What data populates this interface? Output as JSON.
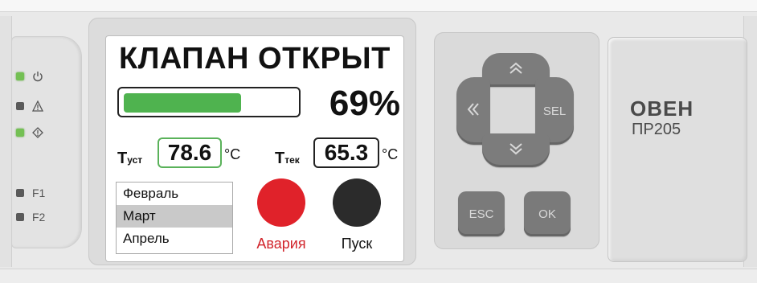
{
  "indicators": [
    {
      "led": "green",
      "icon": "power-icon",
      "label": ""
    },
    {
      "led": "gray",
      "icon": "warning-icon",
      "label": ""
    },
    {
      "led": "green",
      "icon": "diamond-icon",
      "label": ""
    },
    {
      "led": "gray",
      "icon": "",
      "label": "F1"
    },
    {
      "led": "gray",
      "icon": "",
      "label": "F2"
    }
  ],
  "screen": {
    "title": "КЛАПАН ОТКРЫТ",
    "progress": {
      "percent_text": "69%",
      "fraction": 0.69
    },
    "t_set": {
      "label": "T",
      "sub": "уст",
      "value": "78.6",
      "unit": "°C"
    },
    "t_cur": {
      "label": "T",
      "sub": "тек",
      "value": "65.3",
      "unit": "°C"
    },
    "months": [
      {
        "label": "Февраль",
        "selected": false
      },
      {
        "label": "Март",
        "selected": true
      },
      {
        "label": "Апрель",
        "selected": false
      }
    ],
    "alarm_label": "Авария",
    "start_label": "Пуск"
  },
  "keypad": {
    "up": "up-double-chevron-icon",
    "left": "left-double-chevron-icon",
    "down": "down-double-chevron-icon",
    "sel": "SEL",
    "esc": "ESC",
    "ok": "OK"
  },
  "brand": {
    "name": "ОВЕН",
    "model": "ПР205"
  },
  "colors": {
    "alarm": "#e0222a",
    "start": "#2b2b2b",
    "progress": "#4fb34f",
    "led_on": "#74c054",
    "led_off": "#5a5a5a",
    "alarm_text": "#d1242b"
  }
}
